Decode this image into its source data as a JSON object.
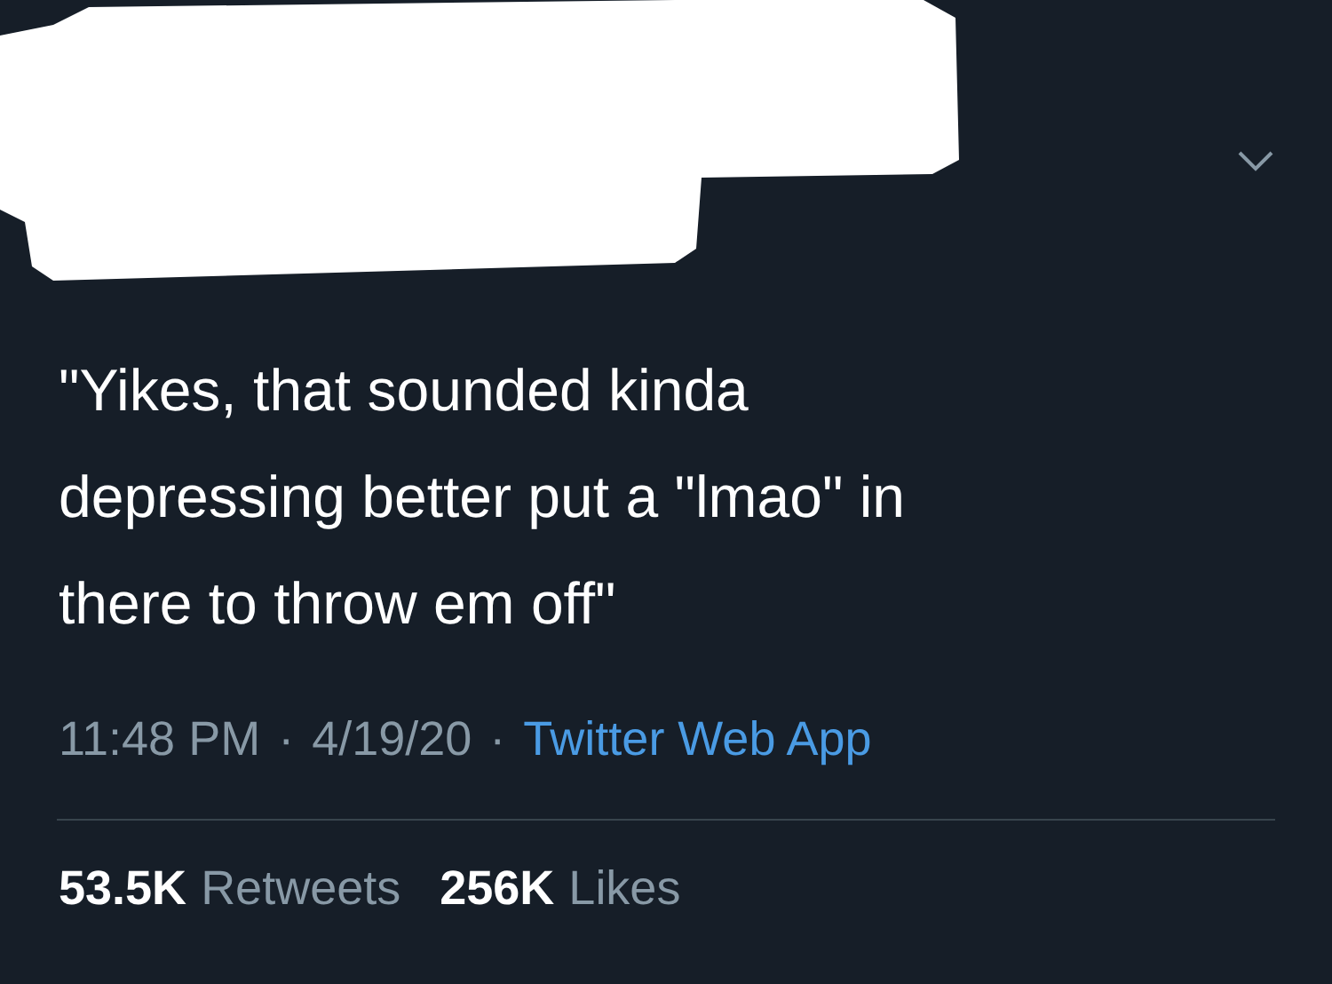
{
  "tweet": {
    "text_lines": [
      "\"Yikes, that sounded kinda",
      "depressing better put a \"lmao\" in",
      "there to throw em off\""
    ],
    "time": "11:48 PM",
    "separator_1": "·",
    "date": "4/19/20",
    "separator_2": "·",
    "source": "Twitter Web App"
  },
  "stats": [
    {
      "count": "53.5K",
      "label": "Retweets"
    },
    {
      "count": "256K",
      "label": "Likes"
    }
  ]
}
